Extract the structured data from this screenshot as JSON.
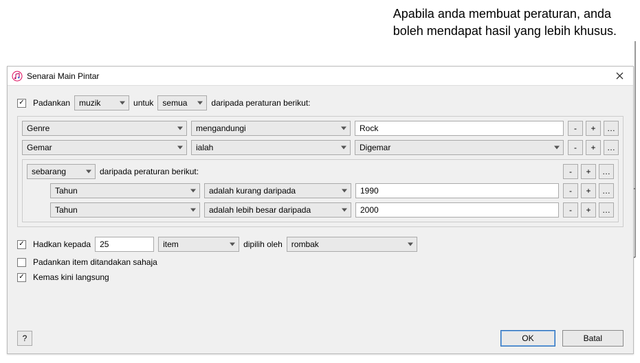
{
  "callout": {
    "line1": "Apabila anda membuat peraturan, anda",
    "line2": "boleh mendapat hasil yang lebih khusus."
  },
  "dialog": {
    "title": "Senarai Main Pintar",
    "match": {
      "label": "Padankan",
      "mediaType": "muzik",
      "forLabel": "untuk",
      "quantifier": "semua",
      "ofRulesLabel": "daripada peraturan berikut:"
    },
    "rules": [
      {
        "field": "Genre",
        "operator": "mengandungi",
        "value": "Rock"
      },
      {
        "field": "Gemar",
        "operator": "ialah",
        "valueSelect": "Digemar"
      }
    ],
    "nested": {
      "quantifier": "sebarang",
      "ofRulesLabel": "daripada peraturan berikut:",
      "rules": [
        {
          "field": "Tahun",
          "operator": "adalah kurang daripada",
          "value": "1990"
        },
        {
          "field": "Tahun",
          "operator": "adalah lebih besar daripada",
          "value": "2000"
        }
      ]
    },
    "limit": {
      "label": "Hadkan kepada",
      "count": "25",
      "unit": "item",
      "selectedByLabel": "dipilih oleh",
      "selectedBy": "rombak"
    },
    "matchCheckedOnly": {
      "label": "Padankan item ditandakan sahaja"
    },
    "liveUpdate": {
      "label": "Kemas kini langsung"
    },
    "buttons": {
      "ok": "OK",
      "cancel": "Batal",
      "help": "?",
      "minus": "-",
      "plus": "+",
      "more": "…"
    }
  }
}
